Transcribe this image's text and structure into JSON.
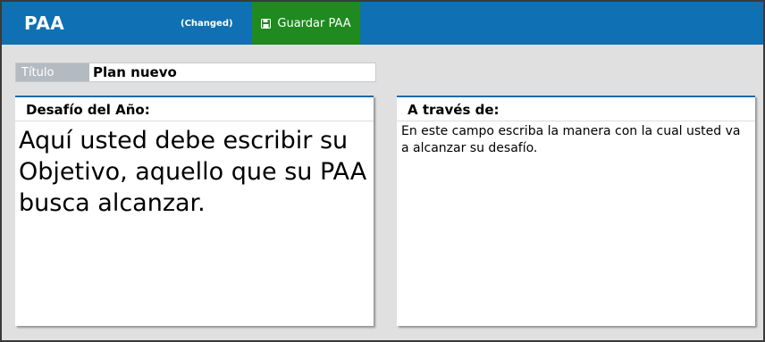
{
  "header": {
    "app_title": "PAA",
    "status": "(Changed)",
    "save_label": "Guardar PAA",
    "background_color": "#0f70b3",
    "save_color": "#1f8a1f"
  },
  "title_field": {
    "label": "Título",
    "value": "Plan nuevo"
  },
  "panels": {
    "challenge": {
      "heading": "Desafío del Año:",
      "text": "Aquí usted debe escribir su Objetivo, aquello que su PAA busca alcanzar."
    },
    "through": {
      "heading": "A través de:",
      "text": "En este campo escriba la manera con la cual usted va a alcanzar su desafío."
    }
  },
  "icons": {
    "save": "floppy-disk-icon"
  }
}
